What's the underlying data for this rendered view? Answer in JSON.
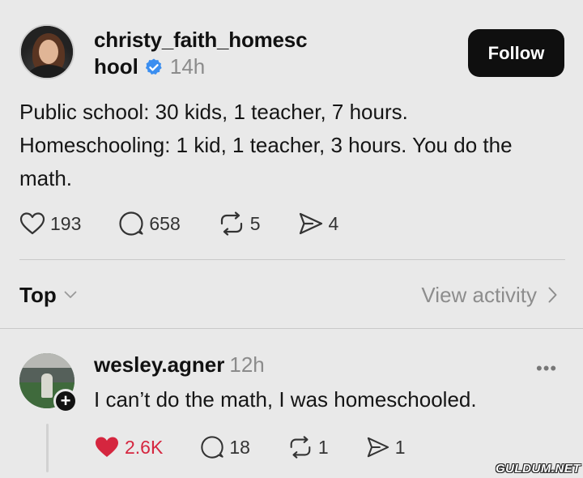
{
  "post": {
    "username_line1": "christy_faith_homesc",
    "username_line2": "hool",
    "verified": true,
    "time": "14h",
    "follow_label": "Follow",
    "text": "Public school: 30 kids, 1 teacher, 7 hours. Homeschooling: 1 kid, 1 teacher, 3 hours. You do the math.",
    "likes": "193",
    "replies": "658",
    "reposts": "5",
    "shares": "4"
  },
  "sortbar": {
    "sort_label": "Top",
    "view_activity_label": "View activity"
  },
  "comment": {
    "username": "wesley.agner",
    "time": "12h",
    "text": "I can’t do the math, I was homeschooled.",
    "likes": "2.6K",
    "liked": true,
    "replies": "18",
    "reposts": "1",
    "shares": "1"
  },
  "watermark": "GULDUM.NET",
  "colors": {
    "background": "#e9e9e9",
    "follow_button": "#0f0f0f",
    "verified_blue": "#3b8ef0",
    "liked_red": "#d5263f",
    "muted_text": "#8b8b8b"
  },
  "icons": [
    "heart-icon",
    "reply-icon",
    "repost-icon",
    "share-icon",
    "verified-badge-icon",
    "chevron-down-icon",
    "chevron-right-icon",
    "more-icon",
    "plus-icon"
  ]
}
